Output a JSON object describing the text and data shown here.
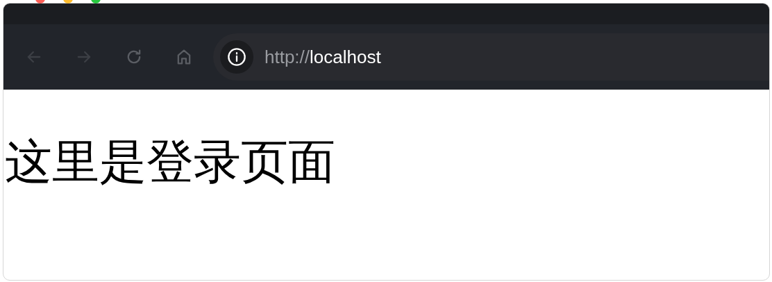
{
  "toolbar": {
    "nav_buttons": [
      {
        "kind": "back",
        "disabled": true
      },
      {
        "kind": "forward",
        "disabled": true
      },
      {
        "kind": "reload",
        "disabled": false
      },
      {
        "kind": "home",
        "disabled": false
      }
    ]
  },
  "address_bar": {
    "scheme": "http://",
    "host": "localhost"
  },
  "page": {
    "heading": "这里是登录页面"
  }
}
